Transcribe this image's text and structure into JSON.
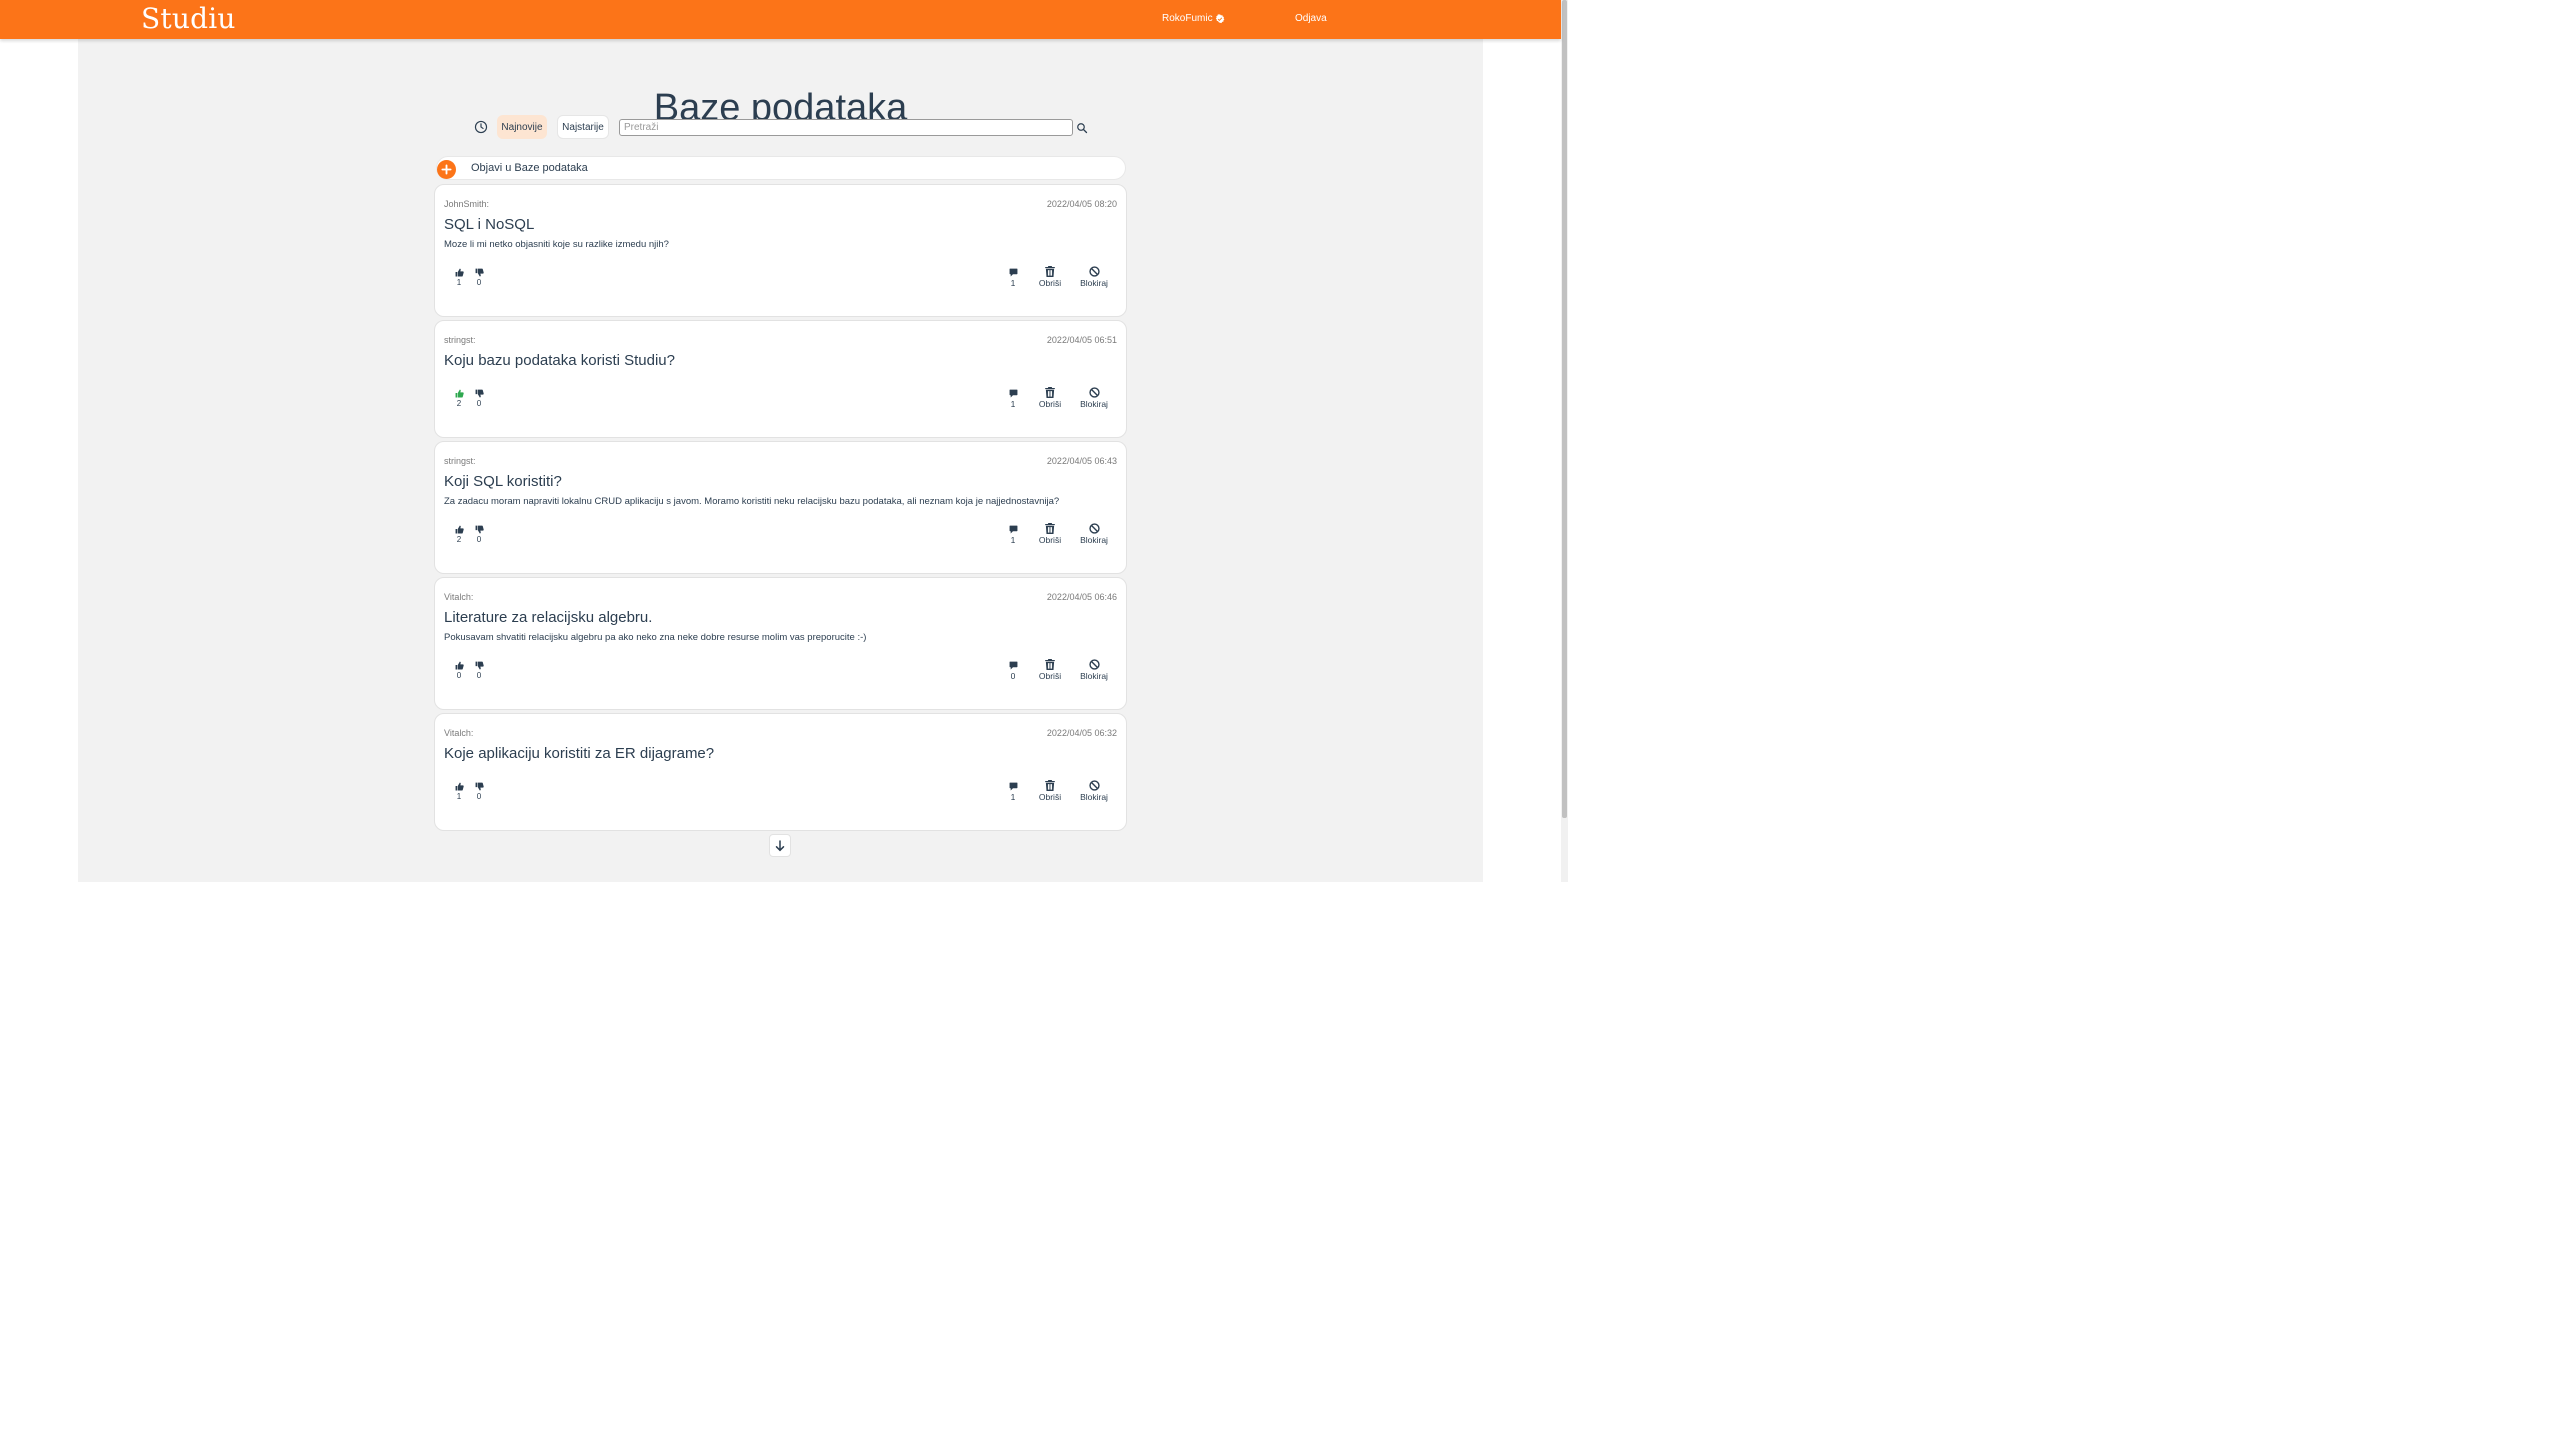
{
  "nav": {
    "logo": "Studiu",
    "username": "RokoFumic",
    "logout_label": "Odjava"
  },
  "page": {
    "title": "Baze podataka"
  },
  "filters": {
    "newest_label": "Najnovije",
    "oldest_label": "Najstarije",
    "search_placeholder": "Pretraži",
    "search_value": ""
  },
  "new_post": {
    "label": "Objavi u Baze podataka"
  },
  "actions": {
    "delete_label": "Obriši",
    "block_label": "Blokiraj"
  },
  "posts": [
    {
      "author": "JohnSmith:",
      "date": "2022/04/05 08:20",
      "title": "SQL i NoSQL",
      "body": "Moze li mi netko objasniti koje su razlike izmedu njih?",
      "likes": "1",
      "dislikes": "0",
      "comments": "1",
      "liked": false
    },
    {
      "author": "stringst:",
      "date": "2022/04/05 06:51",
      "title": "Koju bazu podataka koristi Studiu?",
      "body": "",
      "likes": "2",
      "dislikes": "0",
      "comments": "1",
      "liked": true
    },
    {
      "author": "stringst:",
      "date": "2022/04/05 06:43",
      "title": "Koji SQL koristiti?",
      "body": "Za zadacu moram napraviti lokalnu CRUD aplikaciju s javom. Moramo koristiti neku relacijsku bazu podataka, ali neznam koja je najjednostavnija?",
      "likes": "2",
      "dislikes": "0",
      "comments": "1",
      "liked": false
    },
    {
      "author": "Vitalch:",
      "date": "2022/04/05 06:46",
      "title": "Literature za relacijsku algebru.",
      "body": "Pokusavam shvatiti relacijsku algebru pa ako neko zna neke dobre resurse molim vas preporucite :-)",
      "likes": "0",
      "dislikes": "0",
      "comments": "0",
      "liked": false
    },
    {
      "author": "Vitalch:",
      "date": "2022/04/05 06:32",
      "title": "Koje aplikaciju koristiti za ER dijagrame?",
      "body": "",
      "likes": "1",
      "dislikes": "0",
      "comments": "1",
      "liked": false
    }
  ],
  "colors": {
    "brand": "#fc7418",
    "liked": "#2fa84f",
    "text": "#2c3e50"
  }
}
